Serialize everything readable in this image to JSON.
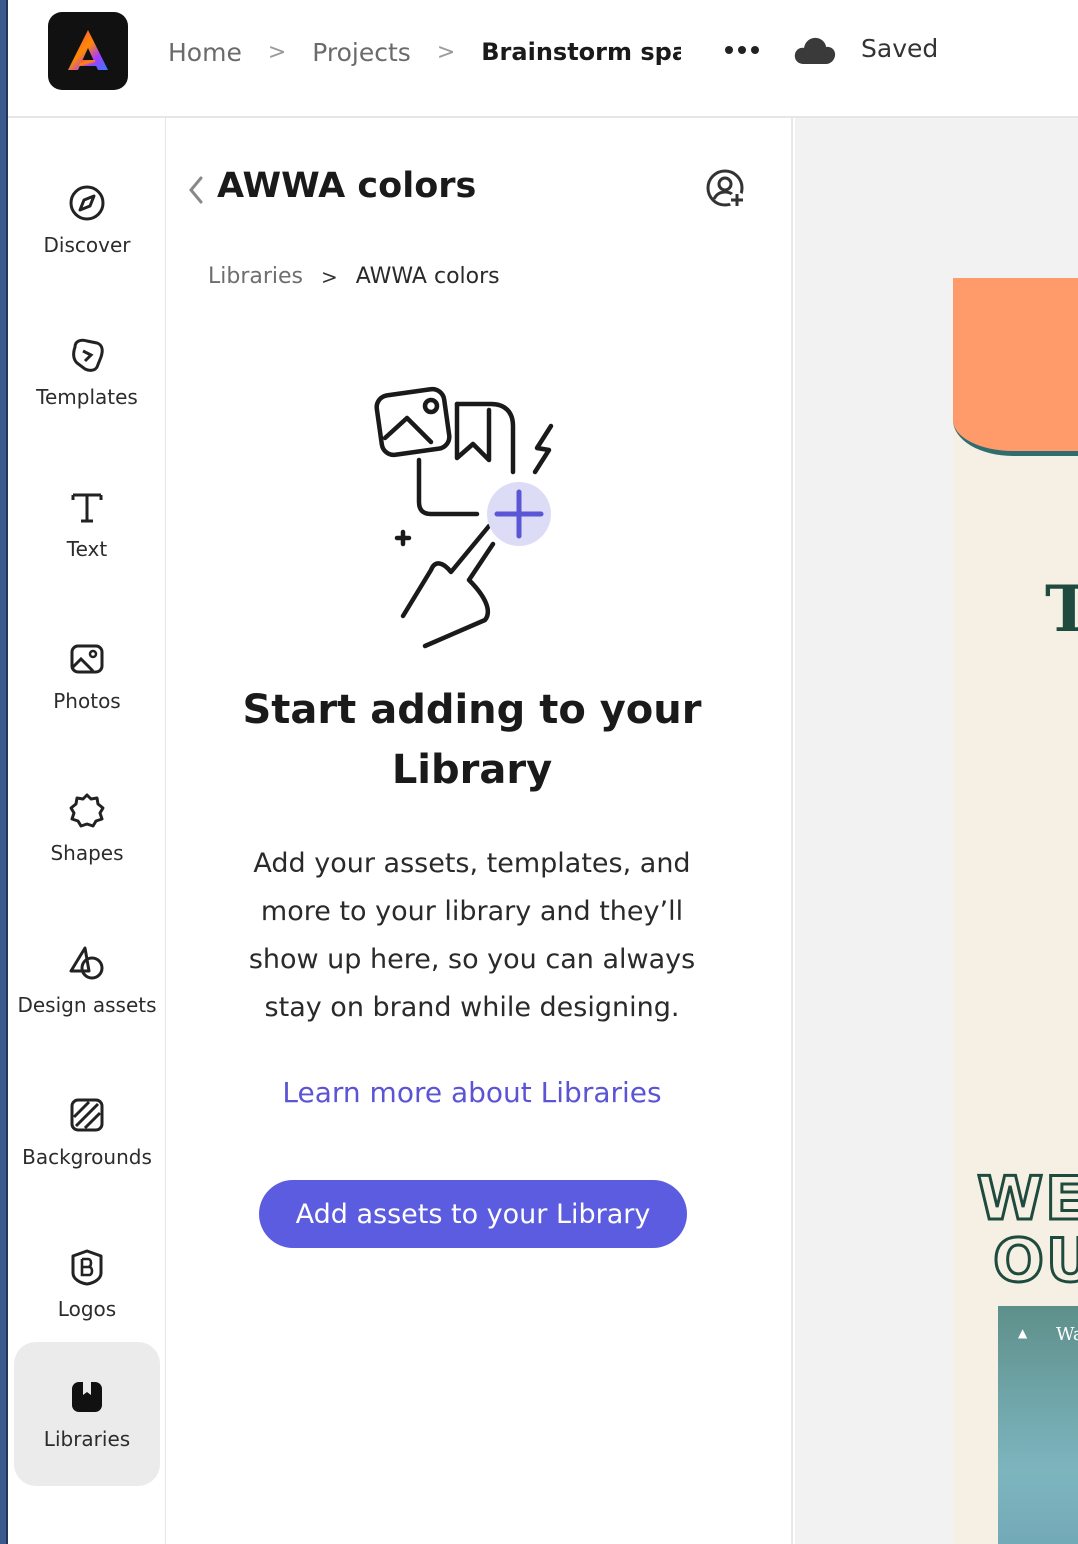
{
  "header": {
    "logo_icon": "adobe-express-logo-icon",
    "breadcrumb": [
      "Home",
      "Projects",
      "Brainstorm space"
    ],
    "separator": ">",
    "more_icon": "more-dots-icon",
    "sync_icon": "cloud-icon",
    "status": "Saved"
  },
  "sidebar": {
    "items": [
      {
        "label": "Discover",
        "icon": "compass-icon"
      },
      {
        "label": "Templates",
        "icon": "templates-icon"
      },
      {
        "label": "Text",
        "icon": "text-icon"
      },
      {
        "label": "Photos",
        "icon": "photo-icon"
      },
      {
        "label": "Shapes",
        "icon": "shapes-icon"
      },
      {
        "label": "Design assets",
        "icon": "design-assets-icon"
      },
      {
        "label": "Backgrounds",
        "icon": "backgrounds-icon"
      },
      {
        "label": "Logos",
        "icon": "logo-badge-icon"
      },
      {
        "label": "Libraries",
        "icon": "library-icon",
        "active": true
      }
    ]
  },
  "panel": {
    "title": "AWWA colors",
    "back_icon": "chevron-left-icon",
    "collab_icon": "invite-user-icon",
    "breadcrumb": {
      "root": "Libraries",
      "current": "AWWA colors"
    },
    "empty_state": {
      "illustration": "add-to-library-illustration",
      "heading": "Start adding to your Library",
      "description": "Add your assets, templates, and more to your library and they’ll show up here, so you can always stay on brand while designing.",
      "link": "Learn more about Libraries",
      "button": "Add assets to your Library"
    }
  },
  "canvas": {
    "visible_text": [
      "T",
      "WE",
      "OU",
      "Wa"
    ]
  },
  "colors": {
    "accent": "#5c5ce0",
    "link": "#5b55d6",
    "artboard_bg": "#f6f0e4",
    "artboard_orange": "#ff9a6a",
    "artboard_green": "#1f4b3f"
  }
}
